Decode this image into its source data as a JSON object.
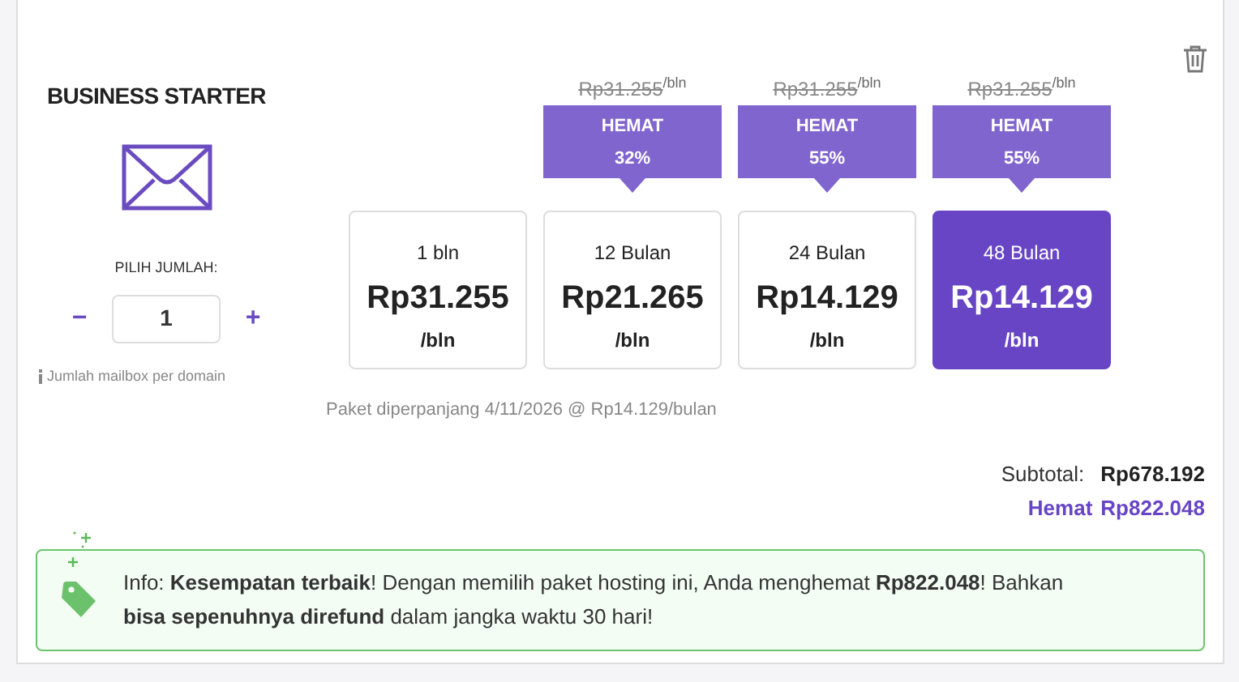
{
  "product": {
    "title": "BUSINESS STARTER",
    "quantity_label": "PILIH JUMLAH:",
    "decrease": "−",
    "quantity": "1",
    "increase": "+",
    "note": "Jumlah mailbox per domain"
  },
  "plans": [
    {
      "period": "1 bln",
      "price": "Rp31.255",
      "unit": "/bln",
      "selected": false
    },
    {
      "original_price": "Rp31.255",
      "original_unit": "/bln",
      "badge_label": "HEMAT",
      "badge_value": "32%",
      "period": "12 Bulan",
      "price": "Rp21.265",
      "unit": "/bln",
      "selected": false
    },
    {
      "original_price": "Rp31.255",
      "original_unit": "/bln",
      "badge_label": "HEMAT",
      "badge_value": "55%",
      "period": "24 Bulan",
      "price": "Rp14.129",
      "unit": "/bln",
      "selected": false
    },
    {
      "original_price": "Rp31.255",
      "original_unit": "/bln",
      "badge_label": "HEMAT",
      "badge_value": "55%",
      "period": "48 Bulan",
      "price": "Rp14.129",
      "unit": "/bln",
      "selected": true
    }
  ],
  "renewal": "Paket diperpanjang 4/11/2026 @ Rp14.129/bulan",
  "subtotal": {
    "label": "Subtotal:",
    "value": "Rp678.192"
  },
  "savings": {
    "label": "Hemat",
    "value": "Rp822.048"
  },
  "info": "Info: **Kesempatan terbaik**! Dengan memilih paket hosting ini, Anda menghemat **Rp822.048**! Bahkan **bisa sepenuhnya direfund** dalam jangka waktu 30 hari!"
}
